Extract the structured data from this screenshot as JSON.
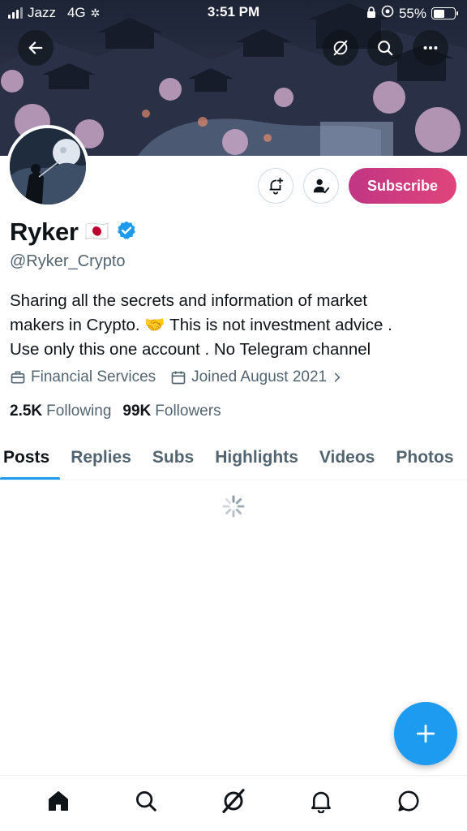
{
  "status_bar": {
    "carrier": "Jazz",
    "network": "4G",
    "time": "3:51 PM",
    "battery": "55%",
    "battery_level": 0.55
  },
  "header": {
    "back_icon": "arrow-left-icon",
    "grok_icon": "grok-icon",
    "search_icon": "search-icon",
    "more_icon": "more-horizontal-icon"
  },
  "profile": {
    "display_name": "Ryker",
    "flag": "🇯🇵",
    "verified": true,
    "handle": "@Ryker_Crypto",
    "bio_lines": [
      "Sharing all the secrets and information of market",
      "makers in Crypto. 🤝 This is not investment advice .",
      "Use only this one account . No Telegram channel"
    ],
    "category": "Financial Services",
    "joined": "Joined August 2021",
    "following_count": "2.5K",
    "following_label": "Following",
    "followers_count": "99K",
    "followers_label": "Followers"
  },
  "actions": {
    "notify_icon": "bell-plus-icon",
    "follow_icon": "person-check-icon",
    "subscribe_label": "Subscribe",
    "subscribe_color": "#d63d80"
  },
  "tabs": [
    {
      "label": "Posts",
      "active": true
    },
    {
      "label": "Replies",
      "active": false
    },
    {
      "label": "Subs",
      "active": false
    },
    {
      "label": "Highlights",
      "active": false
    },
    {
      "label": "Videos",
      "active": false
    },
    {
      "label": "Photos",
      "active": false
    }
  ],
  "colors": {
    "accent": "#1d9bf0",
    "text": "#0f1419",
    "secondary_text": "#536471"
  },
  "bottom_nav": [
    "home-icon",
    "search-icon",
    "grok-icon",
    "notifications-icon",
    "messages-icon"
  ]
}
